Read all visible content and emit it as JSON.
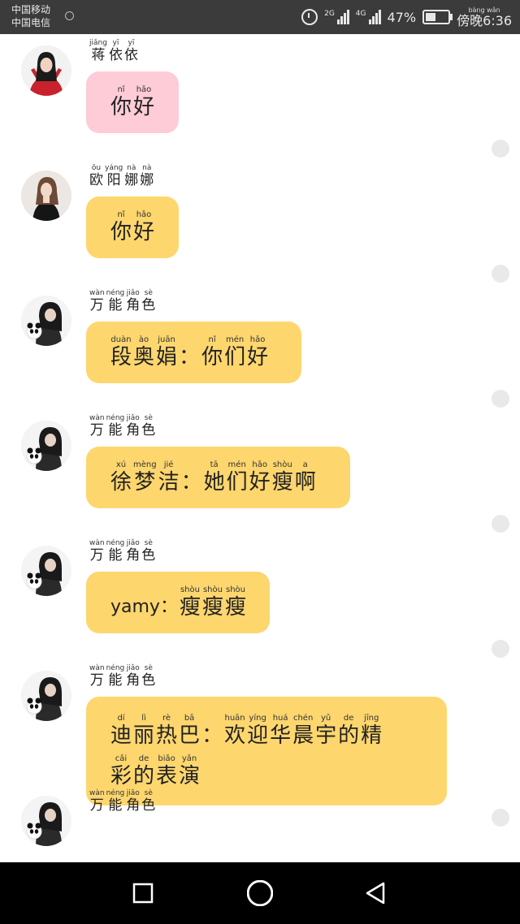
{
  "status_bar": {
    "carrier_1": "中国移动",
    "carrier_2": "中国电信",
    "network_2g": "2G",
    "network_4g": "4G",
    "battery_percent": "47%",
    "battery_level": 0.47,
    "time_label": "傍晚6:36",
    "time_period_pinyin": [
      "bàng",
      "wǎn"
    ]
  },
  "messages": [
    {
      "avatar": "girl-red-outfit-avatar",
      "sender": [
        {
          "py": "jiǎng",
          "hz": "蒋"
        },
        {
          "py": "yī",
          "hz": "依"
        },
        {
          "py": "yī",
          "hz": "依"
        }
      ],
      "bubble_color": "#fdccd7",
      "lines": [
        [
          {
            "py": "nǐ",
            "hz": "你"
          },
          {
            "py": "hǎo",
            "hz": "好"
          }
        ]
      ]
    },
    {
      "avatar": "girl-black-dress-avatar",
      "sender": [
        {
          "py": "ōu",
          "hz": "欧"
        },
        {
          "py": "yáng",
          "hz": "阳"
        },
        {
          "py": "nà",
          "hz": "娜"
        },
        {
          "py": "nà",
          "hz": "娜"
        }
      ],
      "bubble_color": "#fdd66e",
      "lines": [
        [
          {
            "py": "nǐ",
            "hz": "你"
          },
          {
            "py": "hǎo",
            "hz": "好"
          }
        ]
      ]
    },
    {
      "avatar": "girl-with-panda-avatar",
      "sender": [
        {
          "py": "wàn",
          "hz": "万"
        },
        {
          "py": "néng",
          "hz": "能"
        },
        {
          "py": "jiǎo",
          "hz": "角"
        },
        {
          "py": "sè",
          "hz": "色"
        }
      ],
      "bubble_color": "#fdd66e",
      "lines": [
        [
          {
            "py": "duàn",
            "hz": "段"
          },
          {
            "py": "ào",
            "hz": "奥"
          },
          {
            "py": "juān",
            "hz": "娟"
          },
          {
            "py": "",
            "hz": "："
          },
          {
            "py": "nǐ",
            "hz": "你"
          },
          {
            "py": "mén",
            "hz": "们"
          },
          {
            "py": "hǎo",
            "hz": "好"
          }
        ]
      ]
    },
    {
      "avatar": "girl-with-panda-avatar",
      "sender": [
        {
          "py": "wàn",
          "hz": "万"
        },
        {
          "py": "néng",
          "hz": "能"
        },
        {
          "py": "jiǎo",
          "hz": "角"
        },
        {
          "py": "sè",
          "hz": "色"
        }
      ],
      "bubble_color": "#fdd66e",
      "lines": [
        [
          {
            "py": "xú",
            "hz": "徐"
          },
          {
            "py": "mèng",
            "hz": "梦"
          },
          {
            "py": "jié",
            "hz": "洁"
          },
          {
            "py": "",
            "hz": "："
          },
          {
            "py": "tā",
            "hz": "她"
          },
          {
            "py": "mén",
            "hz": "们"
          },
          {
            "py": "hǎo",
            "hz": "好"
          },
          {
            "py": "shòu",
            "hz": "瘦"
          },
          {
            "py": "a",
            "hz": "啊"
          }
        ]
      ]
    },
    {
      "avatar": "girl-with-panda-avatar",
      "sender": [
        {
          "py": "wàn",
          "hz": "万"
        },
        {
          "py": "néng",
          "hz": "能"
        },
        {
          "py": "jiǎo",
          "hz": "角"
        },
        {
          "py": "sè",
          "hz": "色"
        }
      ],
      "bubble_color": "#fdd66e",
      "lines": [
        [
          {
            "plain": "yamy："
          },
          {
            "py": "shòu",
            "hz": "瘦"
          },
          {
            "py": "shòu",
            "hz": "瘦"
          },
          {
            "py": "shòu",
            "hz": "瘦"
          }
        ]
      ]
    },
    {
      "avatar": "girl-with-panda-avatar",
      "sender": [
        {
          "py": "wàn",
          "hz": "万"
        },
        {
          "py": "néng",
          "hz": "能"
        },
        {
          "py": "jiǎo",
          "hz": "角"
        },
        {
          "py": "sè",
          "hz": "色"
        }
      ],
      "bubble_color": "#fdd66e",
      "lines": [
        [
          {
            "py": "dí",
            "hz": "迪"
          },
          {
            "py": "lì",
            "hz": "丽"
          },
          {
            "py": "rè",
            "hz": "热"
          },
          {
            "py": "bā",
            "hz": "巴"
          },
          {
            "py": "",
            "hz": "："
          },
          {
            "py": "huān",
            "hz": "欢"
          },
          {
            "py": "yíng",
            "hz": "迎"
          },
          {
            "py": "huá",
            "hz": "华"
          },
          {
            "py": "chén",
            "hz": "晨"
          },
          {
            "py": "yǔ",
            "hz": "宇"
          },
          {
            "py": "de",
            "hz": "的"
          },
          {
            "py": "jīng",
            "hz": "精"
          }
        ],
        [
          {
            "py": "cǎi",
            "hz": "彩"
          },
          {
            "py": "de",
            "hz": "的"
          },
          {
            "py": "biǎo",
            "hz": "表"
          },
          {
            "py": "yǎn",
            "hz": "演"
          }
        ]
      ]
    },
    {
      "avatar": "girl-with-panda-avatar",
      "sender": [
        {
          "py": "wàn",
          "hz": "万"
        },
        {
          "py": "néng",
          "hz": "能"
        },
        {
          "py": "jiǎo",
          "hz": "角"
        },
        {
          "py": "sè",
          "hz": "色"
        }
      ],
      "bubble_color": "#fdd66e",
      "lines": []
    }
  ],
  "nav_bar": {
    "back_icon": "triangle-back-icon",
    "home_icon": "circle-home-icon",
    "recent_icon": "square-recent-apps-icon"
  }
}
